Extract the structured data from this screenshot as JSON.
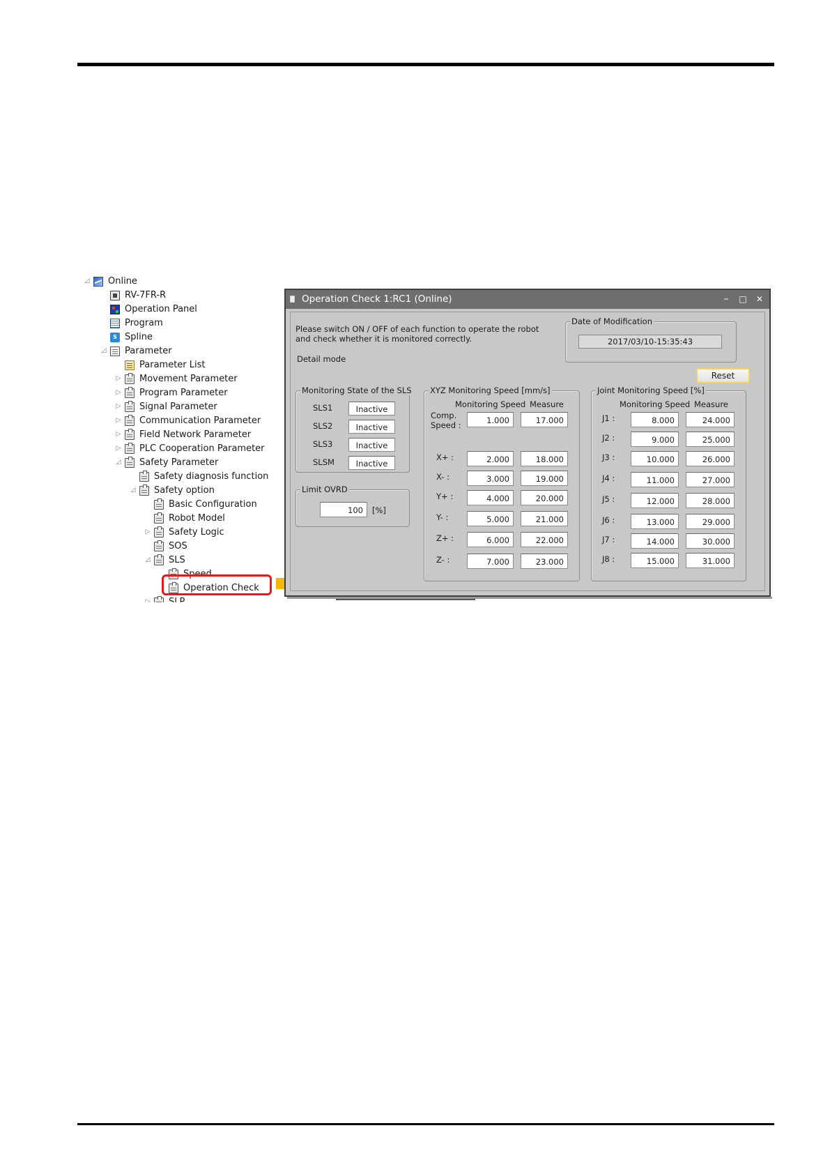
{
  "tree": {
    "items": [
      {
        "label": "Online",
        "icon": "online-icon"
      },
      {
        "label": "RV-7FR-R",
        "icon": "robot-icon"
      },
      {
        "label": "Operation Panel",
        "icon": "operation-panel-icon"
      },
      {
        "label": "Program",
        "icon": "program-icon"
      },
      {
        "label": "Spline",
        "icon": "spline-icon"
      },
      {
        "label": "Parameter",
        "icon": "parameter-icon"
      },
      {
        "label": "Parameter List",
        "icon": "parameter-list-icon"
      },
      {
        "label": "Movement Parameter",
        "icon": "clipboard-icon"
      },
      {
        "label": "Program Parameter",
        "icon": "clipboard-icon"
      },
      {
        "label": "Signal Parameter",
        "icon": "clipboard-icon"
      },
      {
        "label": "Communication Parameter",
        "icon": "clipboard-icon"
      },
      {
        "label": "Field Network Parameter",
        "icon": "clipboard-icon"
      },
      {
        "label": "PLC Cooperation Parameter",
        "icon": "clipboard-icon"
      },
      {
        "label": "Safety Parameter",
        "icon": "clipboard-icon"
      },
      {
        "label": "Safety diagnosis function",
        "icon": "clipboard-icon"
      },
      {
        "label": "Safety option",
        "icon": "clipboard-icon"
      },
      {
        "label": "Basic Configuration",
        "icon": "clipboard-icon"
      },
      {
        "label": "Robot Model",
        "icon": "clipboard-icon"
      },
      {
        "label": "Safety Logic",
        "icon": "clipboard-icon"
      },
      {
        "label": "SOS",
        "icon": "clipboard-icon"
      },
      {
        "label": "SLS",
        "icon": "clipboard-icon"
      },
      {
        "label": "Speed",
        "icon": "clipboard-icon"
      },
      {
        "label": "Operation Check",
        "icon": "clipboard-icon"
      },
      {
        "label": "SLP",
        "icon": "clipboard-icon"
      }
    ]
  },
  "window": {
    "title": "Operation Check 1:RC1 (Online)",
    "instruction_line1": "Please switch ON / OFF of each function to operate the robot",
    "instruction_line2": "and check whether it is monitored correctly.",
    "detail_mode": "Detail mode",
    "date_group_title": "Date of Modification",
    "date_value": "2017/03/10-15:35:43",
    "reset_label": "Reset",
    "minimize": "–",
    "maximize": "□",
    "close": "✕"
  },
  "sls_group": {
    "title": "Monitoring State of the SLS",
    "rows": [
      {
        "label": "SLS1",
        "value": "Inactive"
      },
      {
        "label": "SLS2",
        "value": "Inactive"
      },
      {
        "label": "SLS3",
        "value": "Inactive"
      },
      {
        "label": "SLSM",
        "value": "Inactive"
      }
    ]
  },
  "limit_group": {
    "title": "Limit OVRD",
    "value": "100",
    "unit": "[%]"
  },
  "xyz_group": {
    "title": "XYZ  Monitoring Speed [mm/s]",
    "col_speed": "Monitoring Speed",
    "col_measure": "Measure",
    "comp_label_1": "Comp.",
    "comp_label_2": "Speed :",
    "comp_speed": "1.000",
    "comp_measure": "17.000",
    "rows": [
      {
        "label": "X+ :",
        "speed": "2.000",
        "measure": "18.000"
      },
      {
        "label": "X- :",
        "speed": "3.000",
        "measure": "19.000"
      },
      {
        "label": "Y+ :",
        "speed": "4.000",
        "measure": "20.000"
      },
      {
        "label": "Y- :",
        "speed": "5.000",
        "measure": "21.000"
      },
      {
        "label": "Z+ :",
        "speed": "6.000",
        "measure": "22.000"
      },
      {
        "label": "Z- :",
        "speed": "7.000",
        "measure": "23.000"
      }
    ]
  },
  "joint_group": {
    "title": "Joint  Monitoring Speed [%]",
    "col_speed": "Monitoring Speed",
    "col_measure": "Measure",
    "rows": [
      {
        "label": "J1 :",
        "speed": "8.000",
        "measure": "24.000"
      },
      {
        "label": "J2 :",
        "speed": "9.000",
        "measure": "25.000"
      },
      {
        "label": "J3 :",
        "speed": "10.000",
        "measure": "26.000"
      },
      {
        "label": "J4 :",
        "speed": "11.000",
        "measure": "27.000"
      },
      {
        "label": "J5 :",
        "speed": "12.000",
        "measure": "28.000"
      },
      {
        "label": "J6 :",
        "speed": "13.000",
        "measure": "29.000"
      },
      {
        "label": "J7 :",
        "speed": "14.000",
        "measure": "30.000"
      },
      {
        "label": "J8 :",
        "speed": "15.000",
        "measure": "31.000"
      }
    ]
  },
  "colors": {
    "highlight": "#e41b1b",
    "arrow": "#f5b800",
    "titlebar": "#6e6e6e",
    "window_bg": "#c8c8c8"
  }
}
